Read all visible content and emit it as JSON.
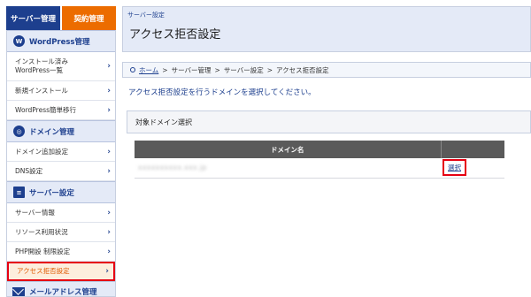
{
  "tabs": {
    "server": "サーバー管理",
    "contract": "契約管理"
  },
  "sidebar": {
    "sections": [
      {
        "title": "WordPress管理",
        "icon": "wordpress-icon",
        "items": [
          {
            "label": "インストール済み\nWordPress一覧"
          },
          {
            "label": "新規インストール"
          },
          {
            "label": "WordPress簡単移行"
          }
        ]
      },
      {
        "title": "ドメイン管理",
        "icon": "globe-icon",
        "items": [
          {
            "label": "ドメイン追加設定"
          },
          {
            "label": "DNS設定"
          }
        ]
      },
      {
        "title": "サーバー設定",
        "icon": "server-icon",
        "items": [
          {
            "label": "サーバー情報"
          },
          {
            "label": "リソース利用状況"
          },
          {
            "label": "PHP開設 制限設定"
          },
          {
            "label": "アクセス拒否設定"
          }
        ]
      }
    ],
    "mail_section": "メールアドレス管理"
  },
  "header": {
    "crumb": "サーバー設定",
    "title": "アクセス拒否設定"
  },
  "breadcrumb": {
    "home": "ホーム",
    "path": [
      ">",
      "サーバー管理",
      ">",
      "サーバー設定",
      ">",
      "アクセス拒否設定"
    ]
  },
  "instruction": "アクセス拒否設定を行うドメインを選択してください。",
  "panel": {
    "title": "対象ドメイン選択",
    "col_domain": "ドメイン名",
    "col_action": "",
    "row_domain": "xxxxxxxxxx.xxx.jp",
    "row_action": "選択"
  },
  "colors": {
    "brand": "#1d3f8e",
    "accent_orange": "#ec6c00",
    "highlight_red": "#e60012"
  }
}
